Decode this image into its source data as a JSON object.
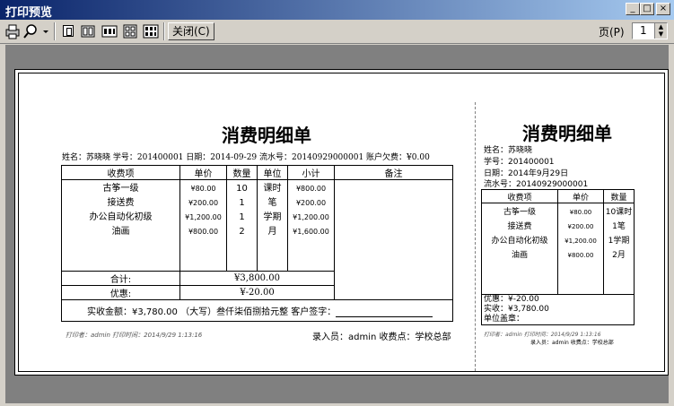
{
  "window": {
    "title": "打印预览"
  },
  "toolbar": {
    "close_label": "关闭(C)",
    "page_label": "页(P)",
    "page_value": "1"
  },
  "receipt_left": {
    "title": "消费明细单",
    "info": "姓名：苏晓晓 学号：201400001 日期：2014-09-29 流水号：20140929000001 账户欠费：¥0.00",
    "headers": [
      "收费项",
      "单价",
      "数量",
      "单位",
      "小计",
      "备注"
    ],
    "items": [
      "古筝一级",
      "接送费",
      "办公自动化初级",
      "油画"
    ],
    "prices": [
      "¥80.00",
      "¥200.00",
      "¥1,200.00",
      "¥800.00"
    ],
    "qtys": [
      "10",
      "1",
      "1",
      "2"
    ],
    "units": [
      "课时",
      "笔",
      "学期",
      "月"
    ],
    "subtotals": [
      "¥800.00",
      "¥200.00",
      "¥1,200.00",
      "¥1,600.00"
    ],
    "total_label": "合计:",
    "total_value": "¥3,800.00",
    "discount_label": "优惠:",
    "discount_value": "¥-20.00",
    "paid_line": "实收金额：¥3,780.00 （大写）叁仟柒佰捌拾元整 客户签字：",
    "printer_line": "打印者：admin 打印时间：2014/9/29 1:13:16",
    "entry_line": "录入员：admin 收费点：学校总部"
  },
  "receipt_right": {
    "title": "消费明细单",
    "name": "姓名：苏晓晓",
    "id": "学号：201400001",
    "date": "日期：2014年9月29日",
    "serial": "流水号：20140929000001",
    "headers": [
      "收费项",
      "单价",
      "数量"
    ],
    "items": [
      "古筝一级",
      "接送费",
      "办公自动化初级",
      "油画"
    ],
    "prices": [
      "¥80.00",
      "¥200.00",
      "¥1,200.00",
      "¥800.00"
    ],
    "qtys": [
      "10课时",
      "1笔",
      "1学期",
      "2月"
    ],
    "discount": "优惠：¥-20.00",
    "paid": "实收：¥3,780.00",
    "stamp": "单位盖章：",
    "printer_line": "打印者：admin 打印时间：2014/9/29 1:13:16",
    "entry_line": "录入员：admin 收费点：学校总部"
  }
}
